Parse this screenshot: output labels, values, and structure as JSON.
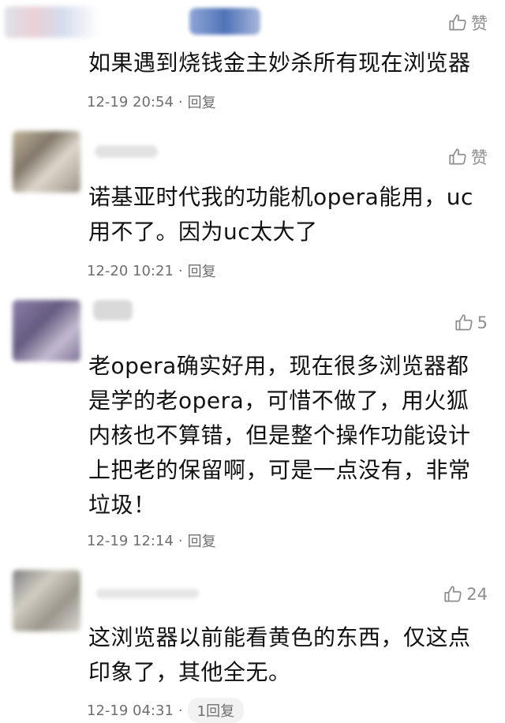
{
  "comments": [
    {
      "like_label": "赞",
      "text": "如果遇到烧钱金主妙杀所有现在浏览器",
      "time": "12-19 20:54",
      "separator": "·",
      "reply_label": "回复"
    },
    {
      "like_label": "赞",
      "text": "诺基亚时代我的功能机opera能用，uc用不了。因为uc太大了",
      "time": "12-20 10:21",
      "separator": "·",
      "reply_label": "回复"
    },
    {
      "like_label": "5",
      "text": "老opera确实好用，现在很多浏览器都是学的老opera，可惜不做了，用火狐内核也不算错，但是整个操作功能设计上把老的保留啊，可是一点没有，非常垃圾！",
      "time": "12-19 12:14",
      "separator": "·",
      "reply_label": "回复"
    },
    {
      "like_label": "24",
      "text": "这浏览器以前能看黄色的东西，仅这点印象了，其他全无。",
      "time": "12-19 04:31",
      "separator": "·",
      "reply_label": "1回复"
    }
  ],
  "colors": {
    "text": "#111111",
    "meta": "#6f6f6f",
    "icon": "#8e8e8e",
    "background": "#ffffff"
  },
  "icons": {
    "like": "thumbs-up-icon"
  }
}
